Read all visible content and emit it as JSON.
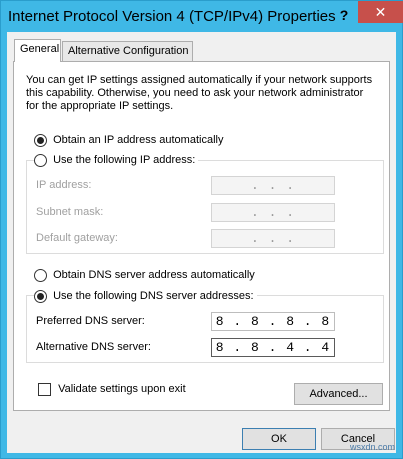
{
  "window": {
    "title": "Internet Protocol Version 4 (TCP/IPv4) Properties",
    "help_label": "?",
    "close_label": "✕"
  },
  "tabs": [
    {
      "label": "General",
      "active": true
    },
    {
      "label": "Alternative Configuration",
      "active": false
    }
  ],
  "description": "You can get IP settings assigned automatically if your network supports this capability. Otherwise, you need to ask your network administrator for the appropriate IP settings.",
  "ip_mode": {
    "auto_label": "Obtain an IP address automatically",
    "manual_label": "Use the following IP address:",
    "selected": "auto"
  },
  "ip_fields": [
    {
      "label": "IP address:",
      "value": ". . ."
    },
    {
      "label": "Subnet mask:",
      "value": ". . ."
    },
    {
      "label": "Default gateway:",
      "value": ". . ."
    }
  ],
  "dns_mode": {
    "auto_label": "Obtain DNS server address automatically",
    "manual_label": "Use the following DNS server addresses:",
    "selected": "manual"
  },
  "dns_fields": [
    {
      "label": "Preferred DNS server:",
      "value": "8 . 8 . 8 . 8"
    },
    {
      "label": "Alternative DNS server:",
      "value": "8 . 8 . 4 . 4"
    }
  ],
  "validate_label": "Validate settings upon exit",
  "buttons": {
    "advanced": "Advanced...",
    "ok": "OK",
    "cancel": "Cancel"
  },
  "watermark": "wsxdn.com"
}
